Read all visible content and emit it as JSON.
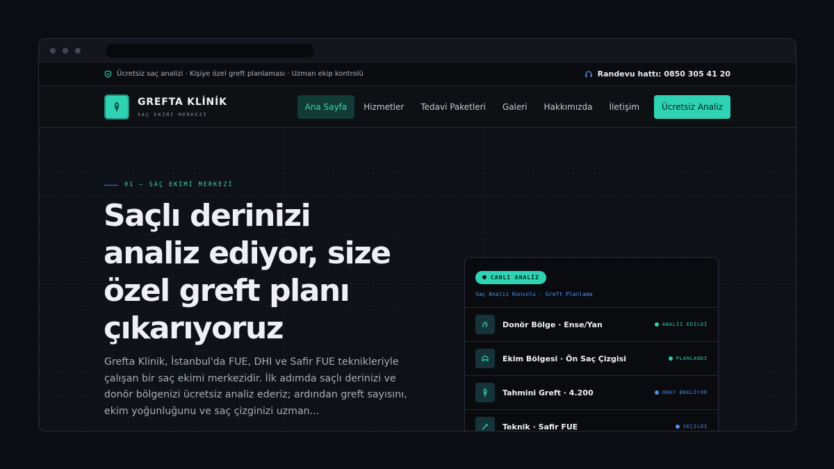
{
  "topbar": {
    "tagline": "Ücretsiz saç analizi · Kişiye özel greft planlaması · Uzman ekip kontrolü",
    "phone": "Randevu hattı: 0850 305 41 20"
  },
  "brand": {
    "name": "GREFTA KLİNİK",
    "subtitle": "SAÇ EKİMİ MERKEZİ"
  },
  "nav": {
    "items": [
      {
        "label": "Ana Sayfa",
        "active": true
      },
      {
        "label": "Hizmetler",
        "active": false
      },
      {
        "label": "Tedavi Paketleri",
        "active": false
      },
      {
        "label": "Galeri",
        "active": false
      },
      {
        "label": "Hakkımızda",
        "active": false
      },
      {
        "label": "İletişim",
        "active": false
      }
    ],
    "cta_label": "Ücretsiz Analiz"
  },
  "hero": {
    "eyebrow": "01 — SAÇ EKİMİ MERKEZİ",
    "headline": "Saçlı derinizi analiz ediyor, size özel greft planı çıkarıyoruz",
    "lead": "Grefta Klinik, İstanbul'da FUE, DHI ve Safir FUE teknikleriyle çalışan bir saç ekimi merkezidir. İlk adımda saçlı derinizi ve donör bölgenizi ücretsiz analiz ederiz; ardından greft sayısını, ekim yoğunluğunu ve saç çizginizi uzman..."
  },
  "console": {
    "badge": "CANLI ANALİZ",
    "subtitle": "Saç Analiz Konsolu · Greft Planlama",
    "rows": [
      {
        "icon": "scalp-icon",
        "label": "Donör Bölge · Ense/Yan",
        "status": "ANALİZ EDİLDİ",
        "status_color": "#2fd3b3"
      },
      {
        "icon": "hairline-icon",
        "label": "Ekim Bölgesi · Ön Saç Çizgisi",
        "status": "PLANLANDI",
        "status_color": "#2fd3b3"
      },
      {
        "icon": "graft-icon",
        "label": "Tahmini Greft · 4.200",
        "status": "ONAY BEKLİYOR",
        "status_color": "#4f8ff0"
      },
      {
        "icon": "sapphire-icon",
        "label": "Teknik · Safir FUE",
        "status": "SEÇİLDİ",
        "status_color": "#4f8ff0"
      }
    ]
  },
  "colors": {
    "accent": "#2fd3b3",
    "blue": "#4f8ff0",
    "background": "#0f1118"
  }
}
